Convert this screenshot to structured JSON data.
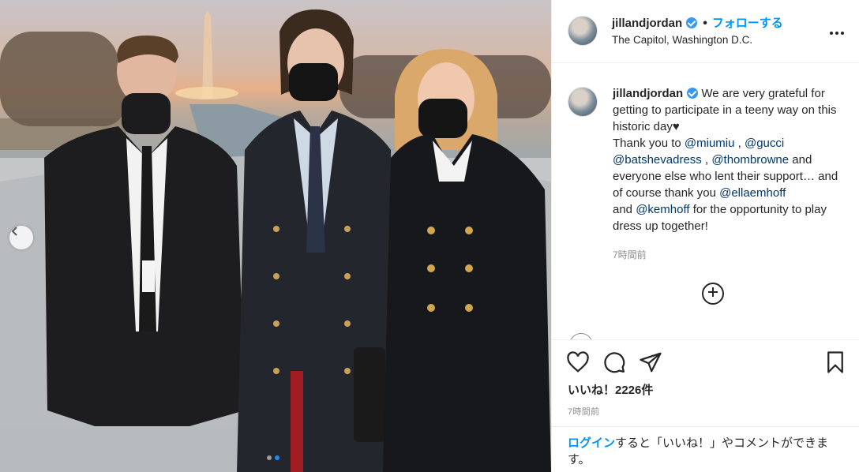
{
  "post": {
    "username": "jillandjordan",
    "follow_label": "フォローする",
    "separator": "•",
    "location": "The Capitol, Washington D.C.",
    "more_icon": "more-horizontal-icon"
  },
  "caption": {
    "username": "jillandjordan",
    "parts": [
      {
        "text": " We are very grateful for getting to participate in a teeny way on this historic day♥",
        "type": "text"
      },
      {
        "text": "Thank you to ",
        "type": "text"
      },
      {
        "text": "@miumiu",
        "type": "mention"
      },
      {
        "text": " , ",
        "type": "text"
      },
      {
        "text": "@gucci",
        "type": "mention"
      },
      {
        "text": "@batshevadress",
        "type": "mention"
      },
      {
        "text": " , ",
        "type": "text"
      },
      {
        "text": "@thombrowne",
        "type": "mention"
      },
      {
        "text": " and everyone else who lent their support… and of course thank you ",
        "type": "text"
      },
      {
        "text": "@ellaemhoff",
        "type": "mention"
      },
      {
        "text": "and ",
        "type": "text"
      },
      {
        "text": "@kemhoff",
        "type": "mention"
      },
      {
        "text": " for the opportunity to play dress up together!",
        "type": "text"
      }
    ],
    "time": "7時間前"
  },
  "actions": {
    "like_icon": "heart-icon",
    "comment_icon": "comment-icon",
    "share_icon": "share-icon",
    "save_icon": "bookmark-icon",
    "likes_text": "いいね！2226件",
    "post_time": "7時間前"
  },
  "login_prompt": {
    "link_label": "ログイン",
    "rest_text": "すると「いいね！」やコメントができます。"
  },
  "carousel": {
    "prev_icon": "chevron-left-icon",
    "dot_count": 2,
    "active_index": 1
  },
  "colors": {
    "accent_blue": "#0095f6",
    "mention_blue": "#00376b",
    "verified_blue": "#3897f0",
    "muted_gray": "#8e8e8e"
  }
}
